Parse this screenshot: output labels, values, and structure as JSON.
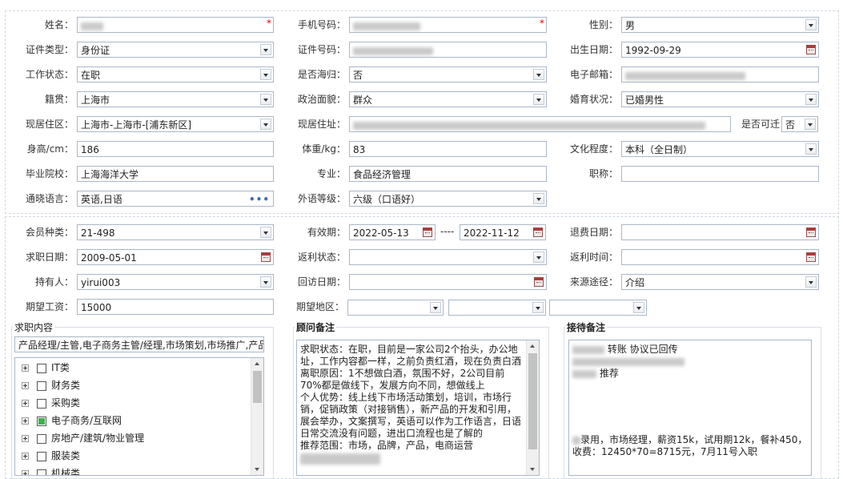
{
  "personal": {
    "name_label": "姓名：",
    "name_value": "",
    "phone_label": "手机号码：",
    "gender_label": "性别：",
    "gender_value": "男",
    "id_type_label": "证件类型：",
    "id_type_value": "身份证",
    "id_no_label": "证件号码：",
    "birth_label": "出生日期：",
    "birth_value": "1992-09-29",
    "work_status_label": "工作状态：",
    "work_status_value": "在职",
    "returnee_label": "是否海归：",
    "returnee_value": "否",
    "email_label": "电子邮箱：",
    "native_label": "籍贯：",
    "native_value": "上海市",
    "politics_label": "政治面貌：",
    "politics_value": "群众",
    "marital_label": "婚育状况：",
    "marital_value": "已婚男性",
    "residence_area_label": "现居住区：",
    "residence_area_value": "上海市-上海市-[浦东新区]",
    "address_label": "现居住址：",
    "transfer_label": "是否可迁",
    "transfer_value": "否",
    "height_label": "身高/cm：",
    "height_value": "186",
    "weight_label": "体重/kg：",
    "weight_value": "83",
    "education_label": "文化程度：",
    "education_value": "本科（全日制）",
    "school_label": "毕业院校：",
    "school_value": "上海海洋大学",
    "major_label": "专业：",
    "major_value": "食品经济管理",
    "title_label": "职称：",
    "title_value": "",
    "language_label": "通晓语言：",
    "language_value": "英语,日语",
    "language_more": "•••",
    "lang_level_label": "外语等级：",
    "lang_level_value": "六级（口语好）"
  },
  "member": {
    "type_label": "会员种类：",
    "type_value": "21-498",
    "valid_label": "有效期：",
    "valid_from": "2022-05-13",
    "valid_sep": "----",
    "valid_to": "2022-11-12",
    "refund_date_label": "退费日期：",
    "job_date_label": "求职日期：",
    "job_date_value": "2009-05-01",
    "rebate_status_label": "返利状态：",
    "rebate_time_label": "返利时间：",
    "holder_label": "持有人：",
    "holder_value": "yirui003",
    "revisit_label": "回访日期：",
    "source_label": "来源途径：",
    "source_value": "介绍",
    "salary_label": "期望工资：",
    "salary_value": "15000",
    "region_label": "期望地区："
  },
  "job_content": {
    "title": "求职内容",
    "summary": "产品经理/主管,电子商务主管/经理,市场策划,市场推广,产品",
    "categories": [
      {
        "label": "IT类",
        "partial": false
      },
      {
        "label": "财务类",
        "partial": false
      },
      {
        "label": "采购类",
        "partial": false
      },
      {
        "label": "电子商务/互联网",
        "partial": true
      },
      {
        "label": "房地产/建筑/物业管理",
        "partial": false
      },
      {
        "label": "服装类",
        "partial": false
      },
      {
        "label": "机械类",
        "partial": false
      }
    ]
  },
  "advisor_notes": {
    "title": "顾问备注",
    "text": "求职状态：在职，目前是一家公司2个抬头，办公地址，工作内容都一样，之前负责红酒，现在负责白酒\n离职原因：1不想做白酒，氛围不好，2公司目前70%都是做线下，发展方向不同，想做线上\n个人优势：线上线下市场活动策划，培训，市场行销，促销政策（对接销售），新产品的开发和引用，展会举办，文案撰写，英语可以作为工作语言，日语日常交流没有问题，进出口流程也是了解的\n推荐范围：市场，品牌，产品，电商运营"
  },
  "reception_notes": {
    "title": "接待备注",
    "line1": "转账 协议已回传",
    "line3": "推荐",
    "result1": "录用，市场经理，薪资15k，试用期12k，餐补450，",
    "result2": "收费：12450*70=8715元，7月11号入职"
  }
}
